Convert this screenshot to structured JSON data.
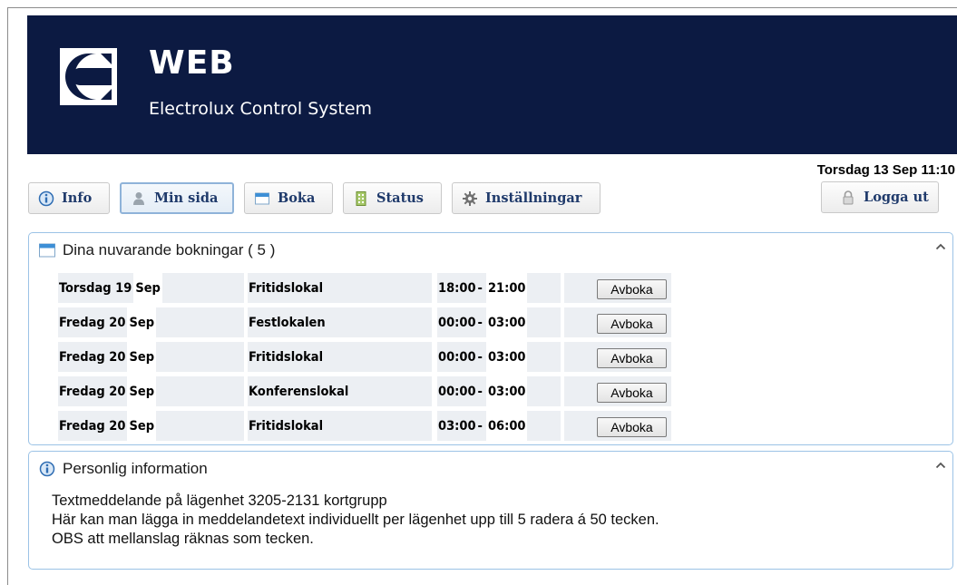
{
  "header": {
    "logo_title": "WEB",
    "logo_subtitle": "Electrolux Control System"
  },
  "datetime": "Torsdag 13 Sep 11:10",
  "nav": {
    "info": "Info",
    "my_page": "Min sida",
    "book": "Boka",
    "status": "Status",
    "settings": "Inställningar",
    "logout": "Logga ut"
  },
  "bookings_panel": {
    "title": "Dina nuvarande bokningar ( 5 )",
    "cancel_label": "Avboka",
    "rows": [
      {
        "day": "Torsdag 19",
        "month": "Sep",
        "room": "Fritidslokal",
        "start": "18:00",
        "sep": "-",
        "end": "21:00"
      },
      {
        "day": "Fredag 20",
        "month": "Sep",
        "room": "Festlokalen",
        "start": "00:00",
        "sep": "-",
        "end": "03:00"
      },
      {
        "day": "Fredag 20",
        "month": "Sep",
        "room": "Fritidslokal",
        "start": "00:00",
        "sep": "-",
        "end": "03:00"
      },
      {
        "day": "Fredag 20",
        "month": "Sep",
        "room": "Konferenslokal",
        "start": "00:00",
        "sep": "-",
        "end": "03:00"
      },
      {
        "day": "Fredag 20",
        "month": "Sep",
        "room": "Fritidslokal",
        "start": "03:00",
        "sep": "-",
        "end": "06:00"
      }
    ]
  },
  "info_panel": {
    "title": "Personlig information",
    "lines": [
      "Textmeddelande på lägenhet 3205-2131 kortgrupp",
      "Här kan man lägga in meddelandetext individuellt per lägenhet upp till 5 radera á 50 tecken.",
      "OBS att mellanslag räknas som tecken."
    ]
  },
  "icons": {
    "logo": "electrolux-logo-icon",
    "info": "info-icon",
    "user": "user-icon",
    "calendar": "calendar-icon",
    "status": "building-icon",
    "settings": "gear-icon",
    "logout": "padlock-icon",
    "collapse": "chevron-up-icon"
  },
  "colors": {
    "banner": "#0c1a42",
    "panel_border": "#9cc3e6",
    "nav_text": "#1f3a6b"
  }
}
